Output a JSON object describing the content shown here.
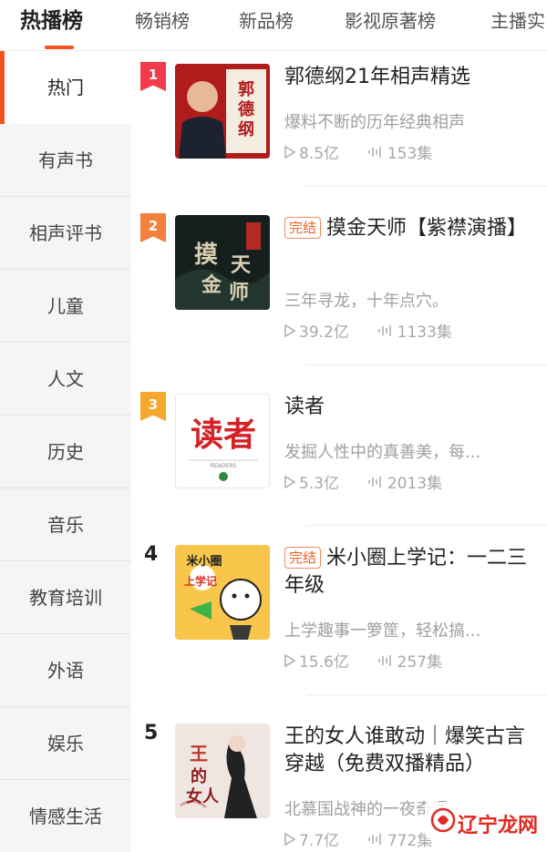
{
  "tabs": [
    {
      "label": "热播榜"
    },
    {
      "label": "畅销榜"
    },
    {
      "label": "新品榜"
    },
    {
      "label": "影视原著榜"
    },
    {
      "label": "主播实"
    }
  ],
  "sidebar": {
    "items": [
      {
        "label": "热门"
      },
      {
        "label": "有声书"
      },
      {
        "label": "相声评书"
      },
      {
        "label": "儿童"
      },
      {
        "label": "人文"
      },
      {
        "label": "历史"
      },
      {
        "label": "音乐"
      },
      {
        "label": "教育培训"
      },
      {
        "label": "外语"
      },
      {
        "label": "娱乐"
      },
      {
        "label": "情感生活"
      }
    ]
  },
  "colors": {
    "accent": "#f4511e",
    "rank1": "#f23c4c",
    "rank2": "#f57f3c",
    "rank3": "#f6a72d"
  },
  "ranking": [
    {
      "rank": "1",
      "title": "郭德纲21年相声精选",
      "done_tag": "",
      "description": "爆料不断的历年经典相声",
      "plays": "8.5亿",
      "episodes": "153集",
      "cover_text": "郭德纲"
    },
    {
      "rank": "2",
      "title": "摸金天师【紫襟演播】",
      "done_tag": "完结",
      "description": "三年寻龙，十年点穴。",
      "plays": "39.2亿",
      "episodes": "1133集",
      "cover_text": "摸金天师"
    },
    {
      "rank": "3",
      "title": "读者",
      "done_tag": "",
      "description": "发掘人性中的真善美，每...",
      "plays": "5.3亿",
      "episodes": "2013集",
      "cover_text": "读者",
      "cover_subtext": "READERS"
    },
    {
      "rank": "4",
      "title": "米小圈上学记：一二三年级",
      "done_tag": "完结",
      "description": "上学趣事一箩筐，轻松搞...",
      "plays": "15.6亿",
      "episodes": "257集",
      "cover_text": "米小圈上学记"
    },
    {
      "rank": "5",
      "title": "王的女人谁敢动｜爆笑古言穿越（免费双播精品）",
      "done_tag": "",
      "description": "北慕国战神的一夜奇遇",
      "plays": "7.7亿",
      "episodes": "772集",
      "cover_text": "王的女人"
    }
  ],
  "watermark": {
    "text": "辽宁龙网"
  }
}
